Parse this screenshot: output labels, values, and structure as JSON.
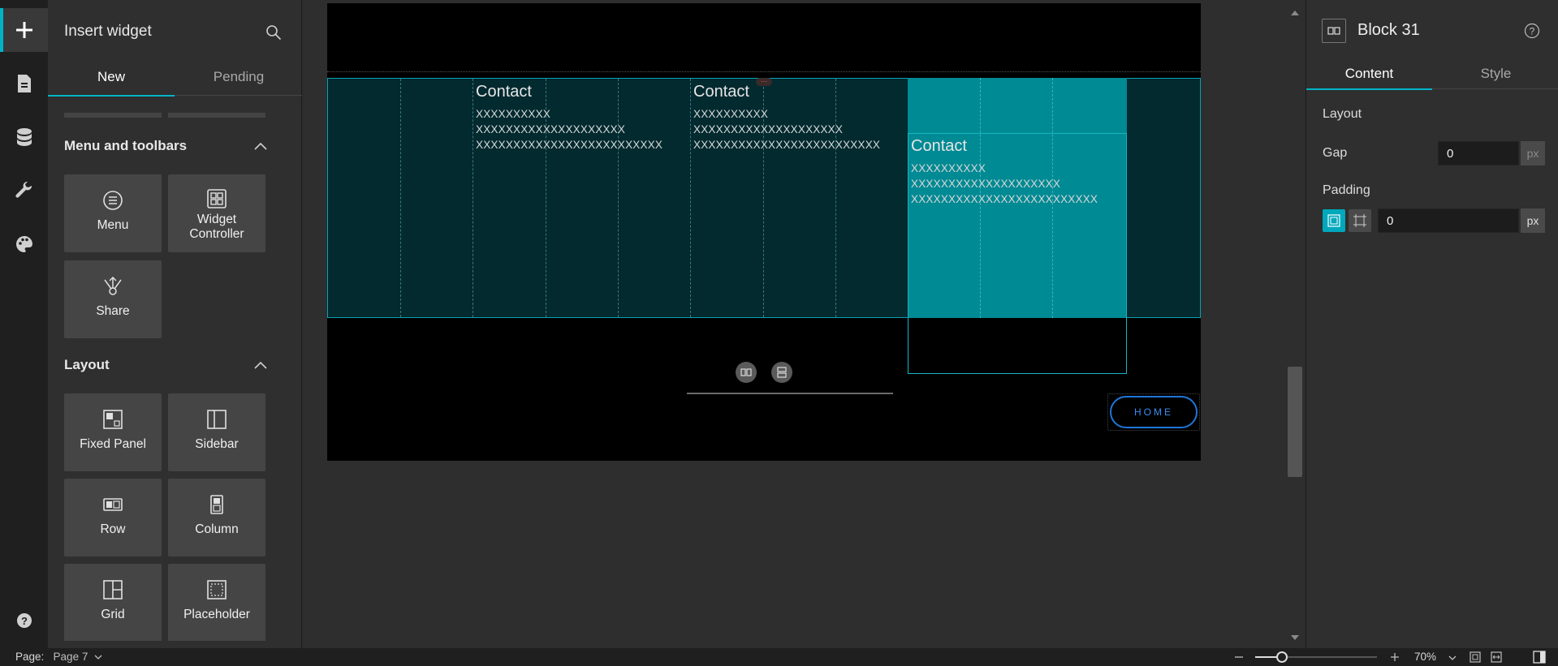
{
  "rail": {
    "items": [
      {
        "name": "insert",
        "icon": "plus-icon"
      },
      {
        "name": "pages",
        "icon": "page-icon"
      },
      {
        "name": "data",
        "icon": "database-icon"
      },
      {
        "name": "tools",
        "icon": "wrench-icon"
      },
      {
        "name": "theme",
        "icon": "palette-icon"
      }
    ],
    "help_icon": "help-icon"
  },
  "insert_panel": {
    "title": "Insert widget",
    "tabs": [
      "New",
      "Pending"
    ],
    "active_tab": "New",
    "sections": [
      {
        "title": "Menu and toolbars",
        "widgets": [
          {
            "label": "Menu",
            "icon": "menu-icon"
          },
          {
            "label": "Widget Controller",
            "icon": "widget-controller-icon"
          },
          {
            "label": "Share",
            "icon": "share-icon"
          }
        ]
      },
      {
        "title": "Layout",
        "widgets": [
          {
            "label": "Fixed Panel",
            "icon": "fixed-panel-icon"
          },
          {
            "label": "Sidebar",
            "icon": "sidebar-icon"
          },
          {
            "label": "Row",
            "icon": "row-icon"
          },
          {
            "label": "Column",
            "icon": "column-icon"
          },
          {
            "label": "Grid",
            "icon": "grid-icon"
          },
          {
            "label": "Placeholder",
            "icon": "placeholder-icon"
          }
        ]
      }
    ]
  },
  "canvas": {
    "contacts": [
      {
        "heading": "Contact",
        "lines": [
          "XXXXXXXXXX",
          "XXXXXXXXXXXXXXXXXXXX",
          "XXXXXXXXXXXXXXXXXXXXXXXXX"
        ]
      },
      {
        "heading": "Contact",
        "lines": [
          "XXXXXXXXXX",
          "XXXXXXXXXXXXXXXXXXXX",
          "XXXXXXXXXXXXXXXXXXXXXXXXX"
        ]
      },
      {
        "heading": "Contact",
        "lines": [
          "XXXXXXXXXX",
          "XXXXXXXXXXXXXXXXXXXX",
          "XXXXXXXXXXXXXXXXXXXXXXXXX"
        ]
      }
    ],
    "handle": "...",
    "home_button": "HOME"
  },
  "properties": {
    "title": "Block 31",
    "tabs": [
      "Content",
      "Style"
    ],
    "active_tab": "Content",
    "layout_label": "Layout",
    "gap_label": "Gap",
    "gap_value": "0",
    "gap_unit": "px",
    "padding_label": "Padding",
    "padding_value": "0",
    "padding_unit": "px"
  },
  "status": {
    "page_label": "Page:",
    "page_value": "Page 7",
    "zoom": "70%"
  },
  "colors": {
    "accent": "#00b4c6",
    "selected_block": "#008a94",
    "row_bg": "#022a2f",
    "home_border": "#1e76d8"
  }
}
